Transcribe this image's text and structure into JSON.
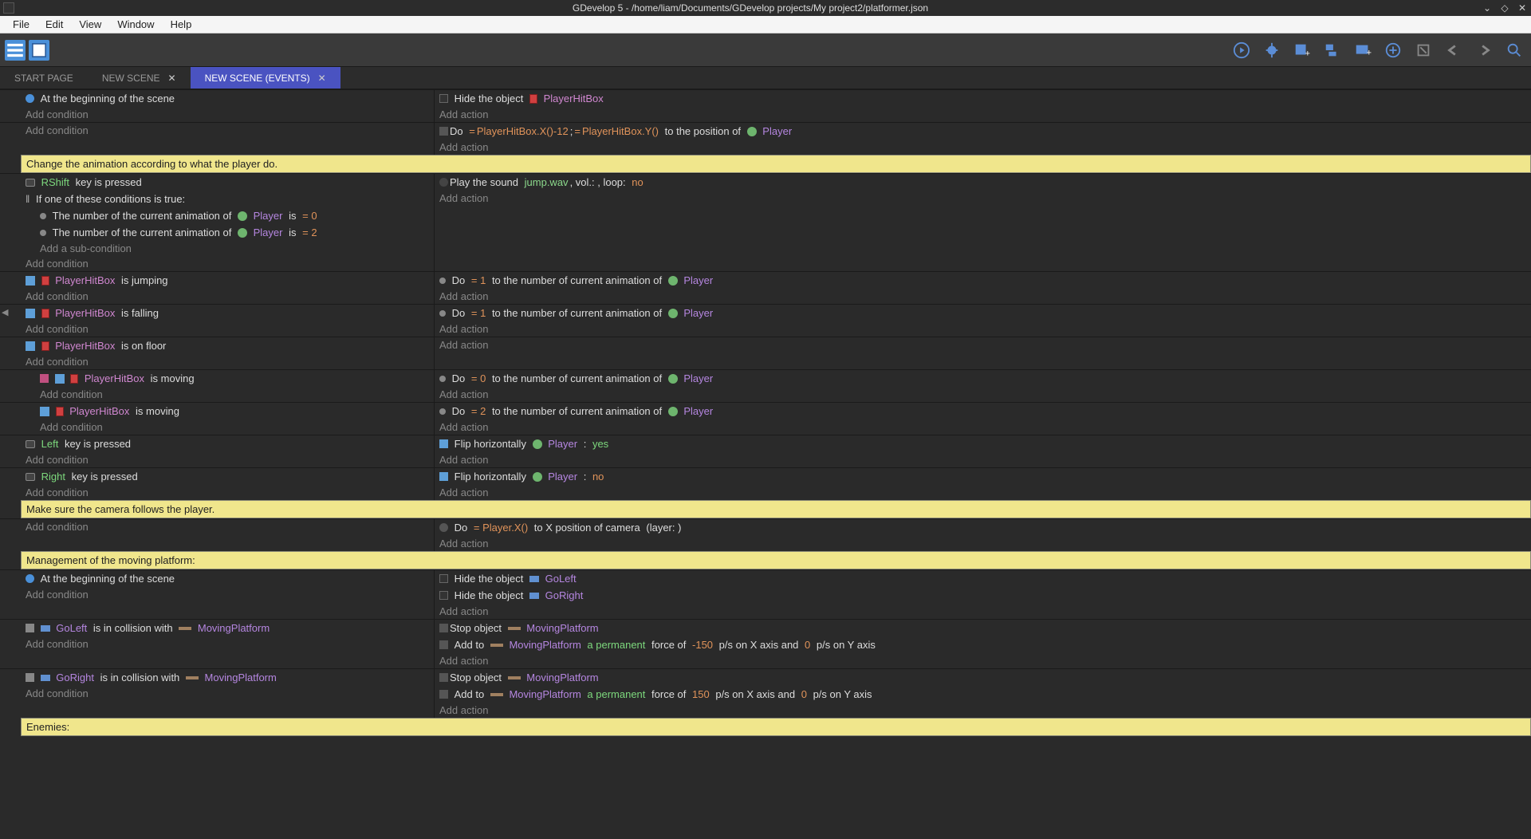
{
  "titlebar": {
    "text": "GDevelop 5 - /home/liam/Documents/GDevelop projects/My project2/platformer.json"
  },
  "menubar": [
    "File",
    "Edit",
    "View",
    "Window",
    "Help"
  ],
  "tabs": [
    {
      "label": "START PAGE",
      "closable": false,
      "active": false
    },
    {
      "label": "NEW SCENE",
      "closable": true,
      "active": false
    },
    {
      "label": "NEW SCENE (EVENTS)",
      "closable": true,
      "active": true
    }
  ],
  "links": {
    "add_condition": "Add condition",
    "add_action": "Add action",
    "add_sub_condition": "Add a sub-condition"
  },
  "comments": {
    "c1": "Change the animation according to what the player do.",
    "c2": "Make sure the camera follows the player.",
    "c3": "Management of the moving platform:",
    "c4": "Enemies:"
  },
  "events": {
    "e1": {
      "cond": {
        "text": "At the beginning of the scene"
      },
      "act": {
        "prefix": "Hide the object",
        "obj": "PlayerHitBox"
      }
    },
    "e2": {
      "act": {
        "pre": "Do",
        "expr1": "PlayerHitBox.X()-12",
        "sep": ";",
        "expr2": "PlayerHitBox.Y()",
        "mid": "to the position of",
        "obj": "Player"
      }
    },
    "e3": {
      "cond_key": "RShift",
      "cond_key_suffix": "key is pressed",
      "cond_or": "If one of these conditions is true:",
      "cond_anim1_pre": "The number of the current animation of",
      "cond_anim1_obj": "Player",
      "cond_anim1_op": "is",
      "cond_anim1_val": "= 0",
      "cond_anim2_val": "= 2",
      "act_pre": "Play the sound",
      "act_file": "jump.wav",
      "act_vol": ", vol.: , loop:",
      "act_loop": "no"
    },
    "e4": {
      "cond_obj": "PlayerHitBox",
      "cond_suf": "is jumping",
      "act_pre": "Do",
      "act_val": "= 1",
      "act_mid": "to the number of current animation of",
      "act_obj": "Player"
    },
    "e5": {
      "cond_obj": "PlayerHitBox",
      "cond_suf": "is falling",
      "act_pre": "Do",
      "act_val": "= 1",
      "act_mid": "to the number of current animation of",
      "act_obj": "Player"
    },
    "e6": {
      "cond_obj": "PlayerHitBox",
      "cond_suf": "is on floor"
    },
    "e7": {
      "cond_obj": "PlayerHitBox",
      "cond_suf": "is moving",
      "act_pre": "Do",
      "act_val": "= 0",
      "act_mid": "to the number of current animation of",
      "act_obj": "Player"
    },
    "e8": {
      "cond_obj": "PlayerHitBox",
      "cond_suf": "is moving",
      "act_pre": "Do",
      "act_val": "= 2",
      "act_mid": "to the number of current animation of",
      "act_obj": "Player"
    },
    "e9": {
      "cond_key": "Left",
      "cond_suf": "key is pressed",
      "act_pre": "Flip horizontally",
      "act_obj": "Player",
      "act_sep": ":",
      "act_val": "yes"
    },
    "e10": {
      "cond_key": "Right",
      "cond_suf": "key is pressed",
      "act_pre": "Flip horizontally",
      "act_obj": "Player",
      "act_sep": ":",
      "act_val": "no"
    },
    "cam": {
      "act_pre": "Do",
      "act_expr": "= Player.X()",
      "act_mid": "to X position of camera",
      "act_layer": "(layer: )"
    },
    "plat1": {
      "cond": "At the beginning of the scene",
      "act1_pre": "Hide the object",
      "act1_obj": "GoLeft",
      "act2_pre": "Hide the object",
      "act2_obj": "GoRight"
    },
    "plat2": {
      "cond_obj": "GoLeft",
      "cond_mid": "is in collision with",
      "cond_obj2": "MovingPlatform",
      "act1_pre": "Stop object",
      "act1_obj": "MovingPlatform",
      "act2_pre": "Add to",
      "act2_obj": "MovingPlatform",
      "act2_perm": "a permanent",
      "act2_mid1": "force of",
      "act2_v1": "-150",
      "act2_mid2": "p/s on X axis and",
      "act2_v2": "0",
      "act2_mid3": "p/s on Y axis"
    },
    "plat3": {
      "cond_obj": "GoRight",
      "cond_mid": "is in collision with",
      "cond_obj2": "MovingPlatform",
      "act1_pre": "Stop object",
      "act1_obj": "MovingPlatform",
      "act2_pre": "Add to",
      "act2_obj": "MovingPlatform",
      "act2_perm": "a permanent",
      "act2_mid1": "force of",
      "act2_v1": "150",
      "act2_mid2": "p/s on X axis and",
      "act2_v2": "0",
      "act2_mid3": "p/s on Y axis"
    }
  }
}
